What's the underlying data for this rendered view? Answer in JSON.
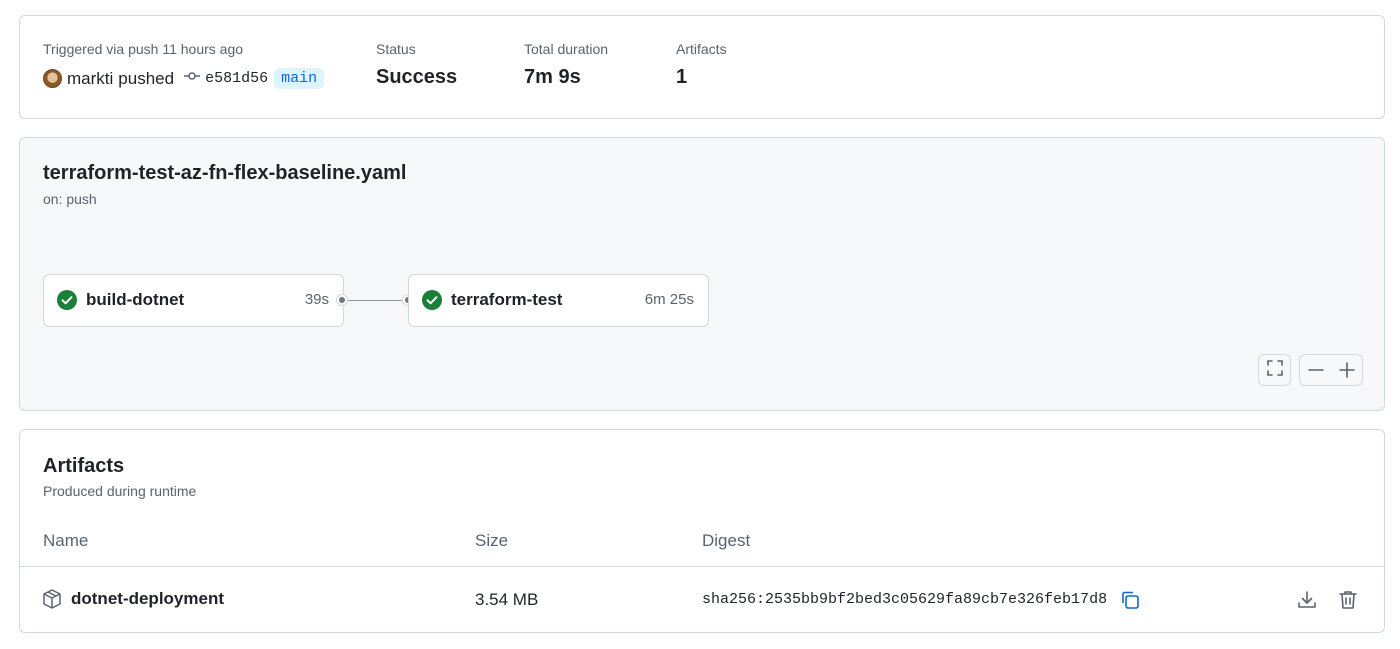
{
  "summary": {
    "trigger_text": "Triggered via push 11 hours ago",
    "actor": "markti",
    "action": "pushed",
    "commit_sha": "e581d56",
    "branch": "main",
    "status_label": "Status",
    "status_value": "Success",
    "duration_label": "Total duration",
    "duration_value": "7m 9s",
    "artifacts_label": "Artifacts",
    "artifacts_value": "1"
  },
  "workflow": {
    "file_name": "terraform-test-az-fn-flex-baseline.yaml",
    "trigger": "on: push",
    "jobs": [
      {
        "name": "build-dotnet",
        "duration": "39s",
        "status": "success"
      },
      {
        "name": "terraform-test",
        "duration": "6m 25s",
        "status": "success"
      }
    ]
  },
  "artifacts": {
    "title": "Artifacts",
    "subtitle": "Produced during runtime",
    "columns": {
      "name": "Name",
      "size": "Size",
      "digest": "Digest"
    },
    "rows": [
      {
        "name": "dotnet-deployment",
        "size": "3.54 MB",
        "digest": "sha256:2535bb9bf2bed3c05629fa89cb7e326feb17d84…"
      }
    ]
  },
  "colors": {
    "success": "#1a7f37",
    "accent": "#0969da",
    "border": "#d1d9e0",
    "muted": "#59636e"
  },
  "icons": [
    "avatar",
    "git-commit-icon",
    "check-circle-icon",
    "fullscreen-icon",
    "zoom-out-icon",
    "zoom-in-icon",
    "package-icon",
    "copy-icon",
    "download-icon",
    "trash-icon"
  ]
}
